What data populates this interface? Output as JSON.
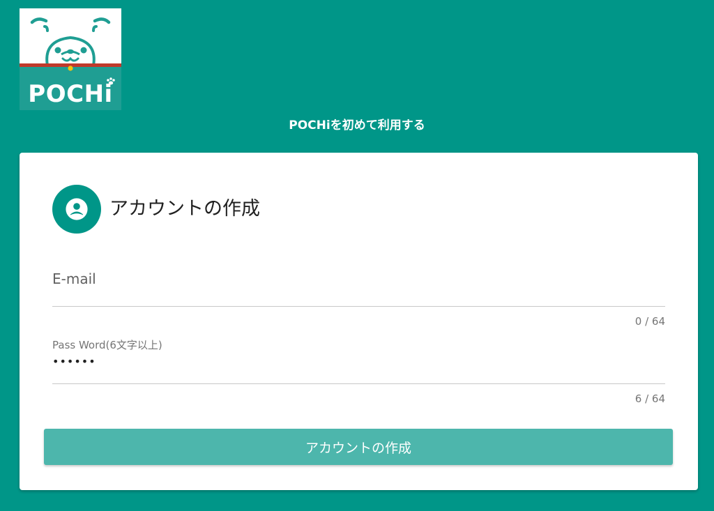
{
  "logo": {
    "text": "POCHi",
    "teal": "#1f9e93",
    "collar": "#c0392b",
    "bell": "#f1c40f"
  },
  "page": {
    "heading": "POCHiを初めて利用する",
    "background": "#009688"
  },
  "card": {
    "icon": "account-circle-icon",
    "title": "アカウントの作成",
    "email": {
      "label": "E-mail",
      "value": "",
      "counter": "0 / 64"
    },
    "password": {
      "label": "Pass Word(6文字以上)",
      "value_masked": "••••••",
      "counter": "6 / 64"
    },
    "submit_label": "アカウントの作成",
    "button_color": "#4db6ac"
  }
}
